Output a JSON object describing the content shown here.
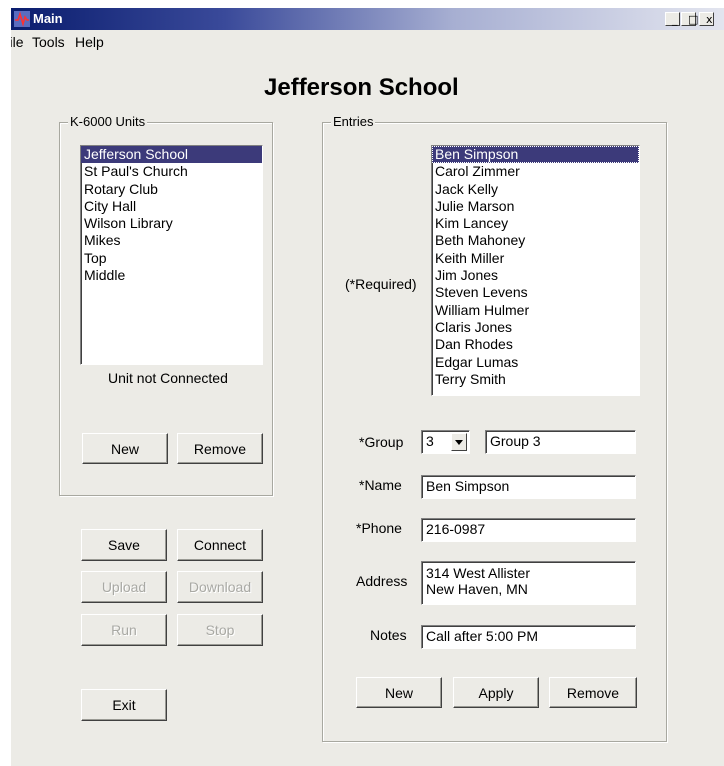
{
  "window": {
    "title": "Main",
    "minimize": "_",
    "maximize": "□",
    "close": "x"
  },
  "menu": {
    "items": [
      "File",
      "Tools",
      "Help"
    ]
  },
  "app_title": "Jefferson School",
  "units_panel": {
    "legend": "K-6000 Units",
    "items": [
      "Jefferson School",
      "St Paul's Church",
      "Rotary Club",
      "City Hall",
      "Wilson Library",
      "Mikes",
      "Top",
      "Middle"
    ],
    "selected": "Jefferson School",
    "status": "Unit not Connected",
    "new_label": "New",
    "remove_label": "Remove"
  },
  "actions": {
    "save": "Save",
    "connect": "Connect",
    "upload": "Upload",
    "download": "Download",
    "run": "Run",
    "stop": "Stop",
    "exit": "Exit"
  },
  "entries_panel": {
    "legend": "Entries",
    "required_note": "(*Required)",
    "items": [
      "Ben Simpson",
      "Carol Zimmer",
      "Jack Kelly",
      "Julie Marson",
      "Kim Lancey",
      "Beth Mahoney",
      "Keith Miller",
      "Jim Jones",
      "Steven Levens",
      "William Hulmer",
      "Claris Jones",
      "Dan Rhodes",
      "Edgar Lumas",
      "Terry Smith"
    ],
    "selected": "Ben Simpson",
    "group_label": "*Group",
    "group_number": "3",
    "group_name": "Group 3",
    "name_label": "*Name",
    "name_value": "Ben Simpson",
    "phone_label": "*Phone",
    "phone_value": "216-0987",
    "address_label": "Address",
    "address_line1": "314 West Allister",
    "address_line2": "New Haven, MN",
    "notes_label": "Notes",
    "notes_value": "Call after 5:00 PM",
    "new_label": "New",
    "apply_label": "Apply",
    "remove_label": "Remove"
  },
  "colors": {
    "window_bg": "#ecebe6",
    "selection": "#3c3a7a",
    "titlebar_start": "#0a1d6e"
  },
  "icons": {
    "app": "app-icon"
  }
}
